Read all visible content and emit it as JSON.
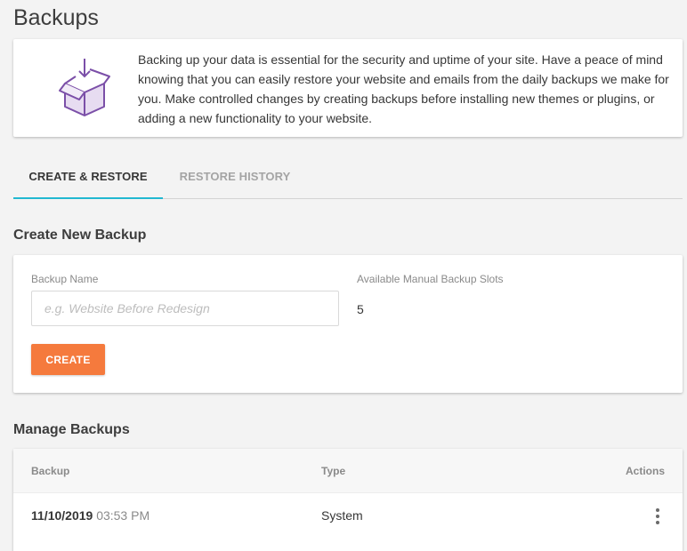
{
  "page": {
    "title": "Backups"
  },
  "intro": {
    "icon": "box-download-icon",
    "text": "Backing up your data is essential for the security and uptime of your site. Have a peace of mind knowing that you can easily restore your website and emails from the daily backups we make for you. Make controlled changes by creating backups before installing new themes or plugins, or adding a new functionality to your website."
  },
  "tabs": [
    {
      "label": "CREATE & RESTORE",
      "active": true
    },
    {
      "label": "RESTORE HISTORY",
      "active": false
    }
  ],
  "create": {
    "section_title": "Create New Backup",
    "name_label": "Backup Name",
    "name_placeholder": "e.g. Website Before Redesign",
    "name_value": "",
    "slots_label": "Available Manual Backup Slots",
    "slots_value": "5",
    "button_label": "CREATE"
  },
  "manage": {
    "section_title": "Manage Backups",
    "columns": {
      "backup": "Backup",
      "type": "Type",
      "actions": "Actions"
    },
    "rows": [
      {
        "date": "11/10/2019",
        "time": "03:53 PM",
        "type": "System",
        "actions_icon": "kebab-menu-icon"
      }
    ]
  },
  "colors": {
    "accent_tab": "#22b8d1",
    "primary_button": "#f57a3d",
    "icon_purple": "#7b4fa8"
  }
}
